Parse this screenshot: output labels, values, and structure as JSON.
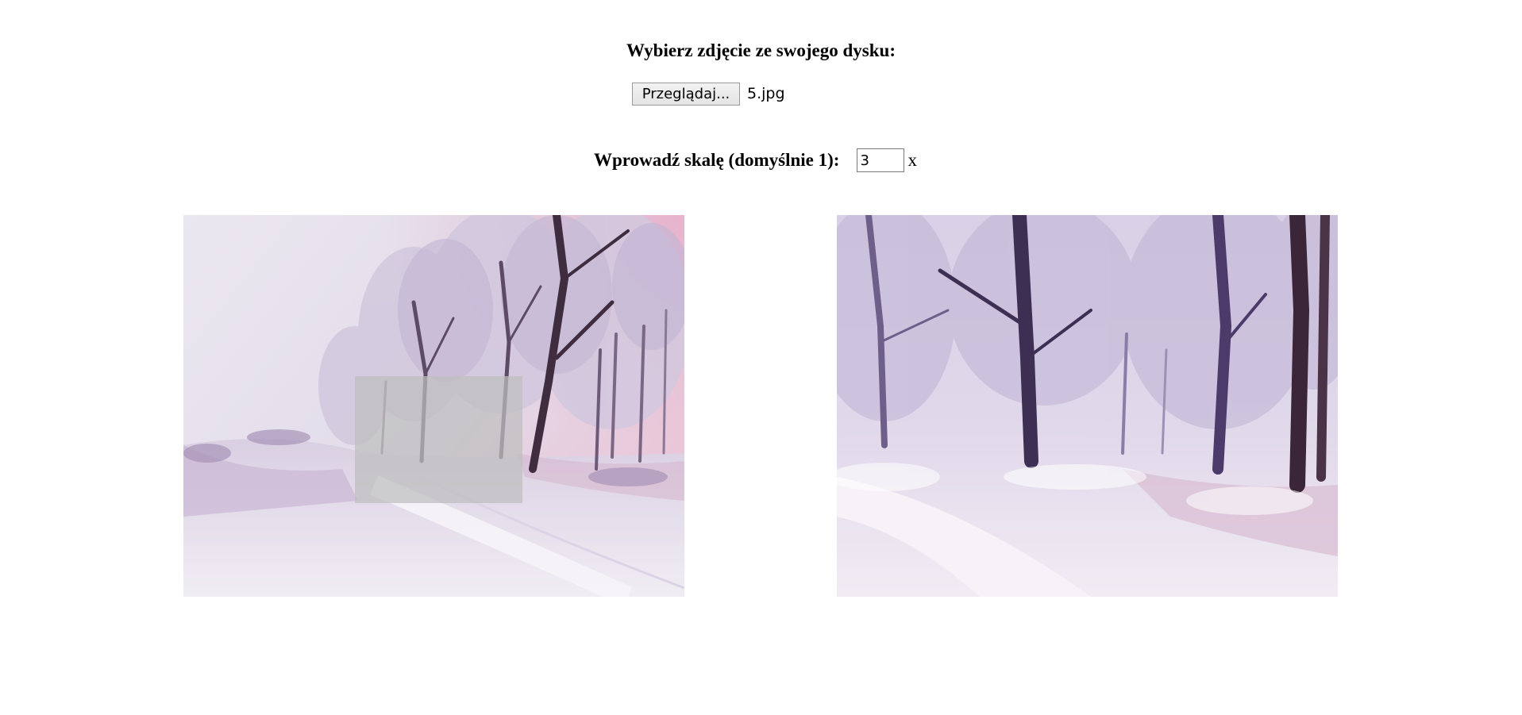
{
  "upload": {
    "heading": "Wybierz zdjęcie ze swojego dysku:",
    "browse_button_label": "Przeglądaj...",
    "file_name": "5.jpg"
  },
  "scale": {
    "label": "Wprowadź skalę (domyślnie 1):",
    "value": "3",
    "unit": "x"
  },
  "images": {
    "original": {
      "subject": "snowy forest path with frosted trees (original image)"
    },
    "zoomed": {
      "subject": "magnified fragment of the snowy forest path"
    }
  },
  "colors": {
    "sky": "#e4e0ec",
    "snow": "#efeaf2",
    "lavender": "#c9bfdc",
    "dark_trunk": "#4a3a52",
    "pink_tint": "#e9bcd0",
    "selection_overlay": "#bebebe"
  }
}
